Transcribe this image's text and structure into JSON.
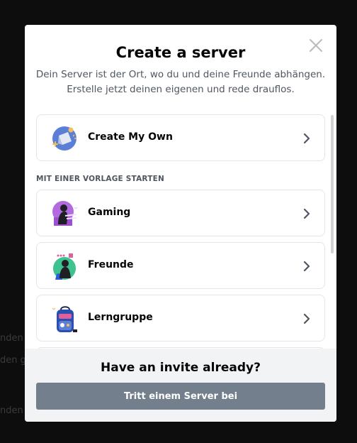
{
  "background": {
    "fragments": [
      "nden",
      "den g",
      "nden"
    ]
  },
  "modal": {
    "title": "Create a server",
    "subtitle": "Dein Server ist der Ort, wo du und deine Freunde abhängen. Erstelle jetzt deinen eigenen und rede drauflos.",
    "create_own": {
      "label": "Create My Own",
      "icon": "create-server-icon"
    },
    "template_section_label": "MIT EINER VORLAGE STARTEN",
    "templates": [
      {
        "label": "Gaming",
        "icon": "gaming-icon"
      },
      {
        "label": "Freunde",
        "icon": "friends-icon"
      },
      {
        "label": "Lerngruppe",
        "icon": "study-group-icon"
      }
    ],
    "footer": {
      "title": "Have an invite already?",
      "join_button": "Tritt einem Server bei"
    }
  },
  "colors": {
    "backdrop": "#0d0d0e",
    "modal_bg": "#ffffff",
    "footer_bg": "#f2f3f5",
    "button_grey": "#747f8d",
    "text_primary": "#060607",
    "text_secondary": "#4f5660"
  }
}
